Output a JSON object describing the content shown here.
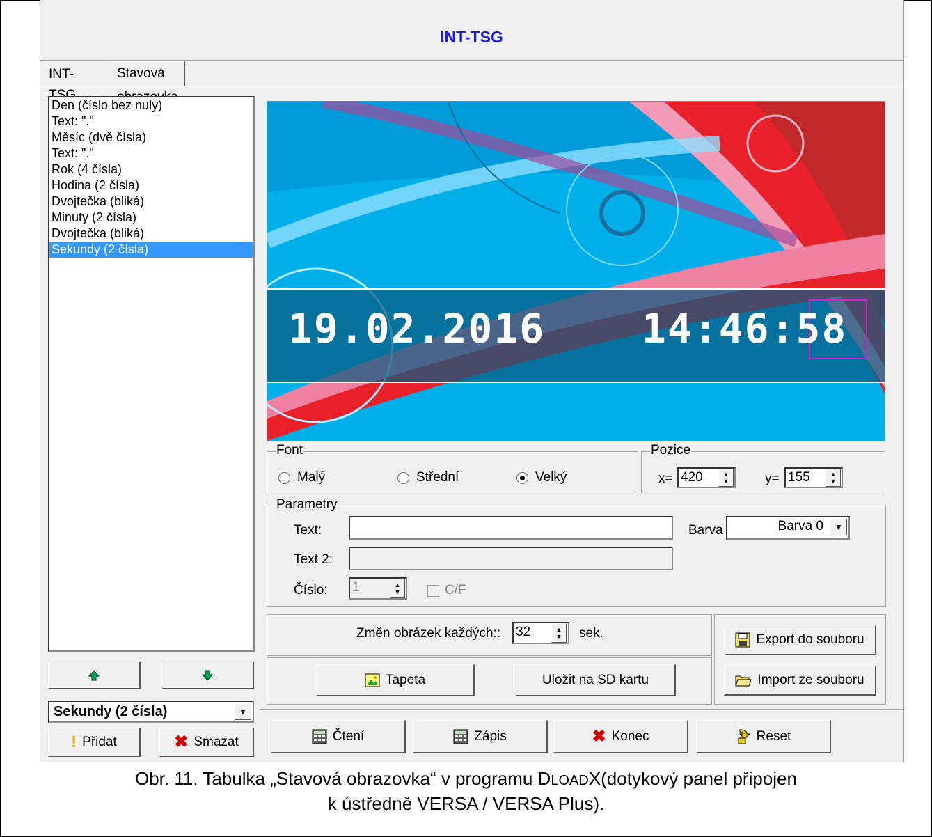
{
  "window": {
    "title": "INT-TSG"
  },
  "tabs": [
    {
      "label": "INT-TSG"
    },
    {
      "label": "Stavová obrazovka"
    }
  ],
  "elements_list": {
    "items": [
      "Den (číslo bez nuly)",
      "Text: \".\"",
      "Měsíc (dvě čísla)",
      "Text: \".\"",
      "Rok (4 čísla)",
      "Hodina (2 čísla)",
      "Dvojtečka (bliká)",
      "Minuty (2 čísla)",
      "Dvojtečka (bliká)",
      "Sekundy (2 čísla)"
    ],
    "selected_index": 9
  },
  "move_buttons": {
    "up_icon": "arrow-up-icon",
    "down_icon": "arrow-down-icon"
  },
  "element_type_select": {
    "value": "Sekundy (2 čísla)"
  },
  "add_button": {
    "label": "Přidat"
  },
  "delete_button": {
    "label": "Smazat"
  },
  "preview": {
    "date": "19.02.2016",
    "hours_minutes": "14:46:",
    "seconds": "58"
  },
  "font_group": {
    "label": "Font",
    "options": [
      "Malý",
      "Střední",
      "Velký"
    ],
    "selected": "Velký"
  },
  "position_group": {
    "label": "Pozice",
    "x_label": "x=",
    "x_value": "420",
    "y_label": "y=",
    "y_value": "155"
  },
  "parameters_group": {
    "label": "Parametry",
    "text_label": "Text:",
    "text_value": "",
    "text2_label": "Text 2:",
    "text2_value": "",
    "number_label": "Číslo:",
    "number_value": "1",
    "cf_label": "C/F",
    "color_label": "Barva",
    "color_value": "Barva 0"
  },
  "change_image": {
    "label": "Změn obrázek každých::",
    "value": "32",
    "unit": "sek."
  },
  "wallpaper_button": {
    "label": "Tapeta"
  },
  "save_sd_button": {
    "label": "Uložit na SD kartu"
  },
  "export_button": {
    "label": "Export do souboru"
  },
  "import_button": {
    "label": "Import ze souboru"
  },
  "bottom_buttons": {
    "read": "Čtení",
    "write": "Zápis",
    "end": "Konec",
    "reset": "Reset"
  },
  "caption": {
    "line1_prefix": "Obr. 11. Tabulka „Stavová obrazovka“ v programu D",
    "line1_smallcaps": "LOAD",
    "line1_suffix": "X(dotykový panel připojen",
    "line2": "k ústředně VERSA / VERSA Plus)."
  },
  "colors": {
    "title": "#1a1adc",
    "selection": "#3399ff",
    "preview_sky": "#00aee8",
    "accent_red": "#e8202a",
    "accent_pink": "#f080a0"
  }
}
